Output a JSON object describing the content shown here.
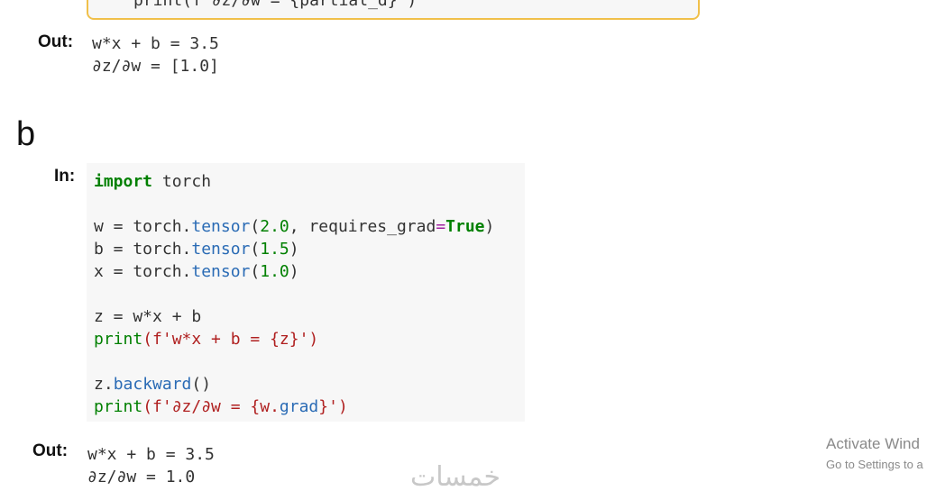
{
  "top_cell": {
    "line": "print(f'∂z/∂w = {partial_d}')"
  },
  "out_a": {
    "label": "Out:",
    "lines": [
      "w*x + b = 3.5",
      "∂z/∂w = [1.0]"
    ]
  },
  "section_b": {
    "label": "b"
  },
  "in_b": {
    "label": "In:",
    "tokens": {
      "import": "import",
      "torch_mod": "torch",
      "w_assign": "w = torch.",
      "tensor": "tensor",
      "open": "(",
      "n2": "2.0",
      "req": ", requires_grad",
      "eq": "=",
      "true_kw": "True",
      "close": ")",
      "b_assign": "b = torch.",
      "n15": "1.5",
      "x_assign": "x = torch.",
      "n10": "1.0",
      "z_line": "z = w*x + b",
      "print": "print",
      "fstr1_pre": "(f'w*x + b = {z}",
      "fstr_end": "')",
      "zback_pre": "z.",
      "backward": "backward",
      "parens": "()",
      "fstr2_pre": "(f'∂z/∂w = {w.",
      "grad": "grad",
      "fstr2_post": "}')"
    }
  },
  "out_b": {
    "label": "Out:",
    "lines": [
      "w*x + b = 3.5",
      "∂z/∂w = 1.0"
    ]
  },
  "watermark": "خمسات",
  "activate": {
    "title": "Activate Wind",
    "subtitle": "Go to Settings to a"
  }
}
